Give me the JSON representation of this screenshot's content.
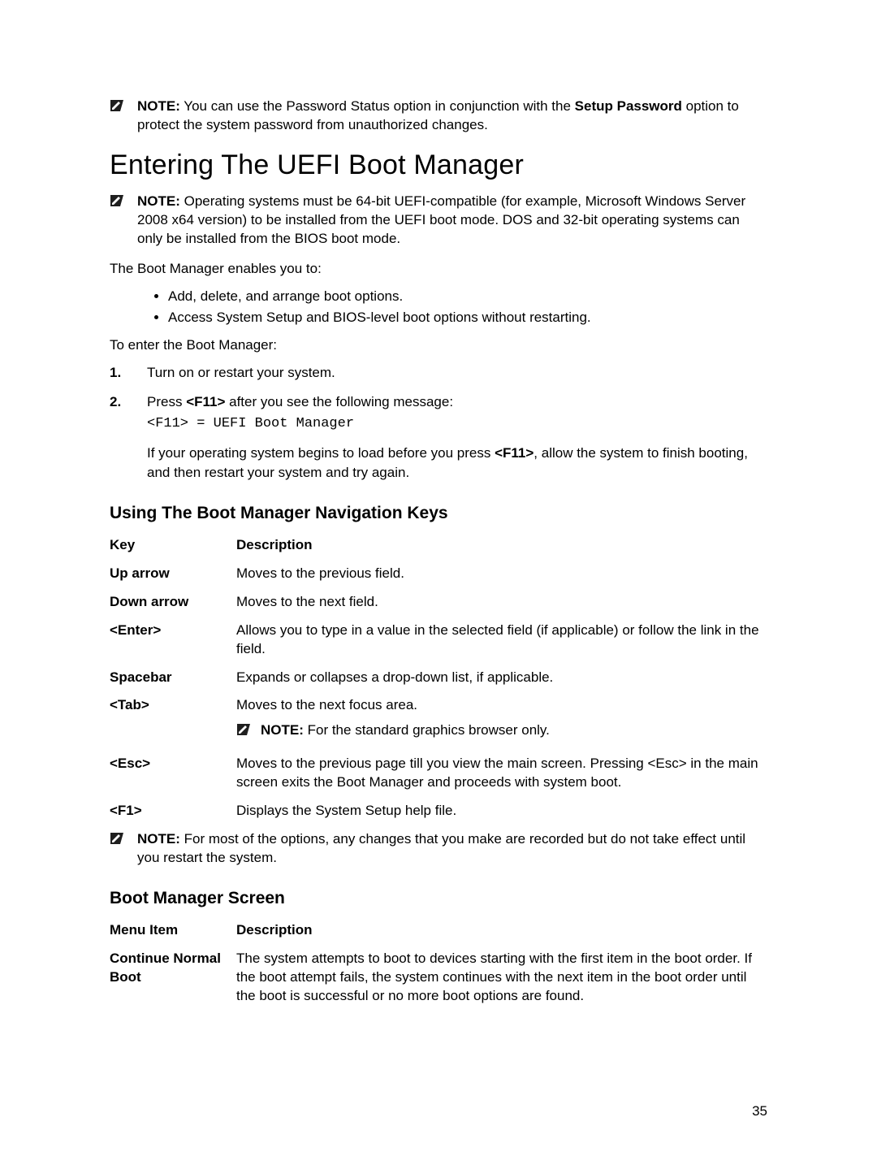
{
  "note_top": {
    "prefix": "NOTE:",
    "pre": " You can use the Password Status option in conjunction with the ",
    "bold": "Setup Password",
    "post": " option to protect the system password from unauthorized changes."
  },
  "heading_main": "Entering The UEFI Boot Manager",
  "note_uefi": {
    "prefix": "NOTE:",
    "body": " Operating systems must be 64-bit UEFI-compatible (for example, Microsoft Windows Server 2008 x64 version) to be installed from the UEFI boot mode. DOS and 32-bit operating systems can only be installed from the BIOS boot mode."
  },
  "para_enables": "The Boot Manager enables you to:",
  "bullets": [
    "Add, delete, and arrange boot options.",
    "Access System Setup and BIOS-level boot options without restarting."
  ],
  "para_to_enter": "To enter the Boot Manager:",
  "steps": {
    "s1": "Turn on or restart your system.",
    "s2_pre": "Press ",
    "s2_key": "<F11>",
    "s2_post": " after you see the following message:",
    "s2_mono": "<F11> = UEFI Boot Manager",
    "s2_sub_pre": "If your operating system begins to load before you press ",
    "s2_sub_key": "<F11>",
    "s2_sub_post": ", allow the system to finish booting, and then restart your system and try again."
  },
  "heading_nav": "Using The Boot Manager Navigation Keys",
  "navkeys": {
    "header_key": "Key",
    "header_desc": "Description",
    "rows": [
      {
        "key": "Up arrow",
        "desc": "Moves to the previous field."
      },
      {
        "key": "Down arrow",
        "desc": "Moves to the next field."
      },
      {
        "key": "<Enter>",
        "desc": "Allows you to type in a value in the selected field (if applicable) or follow the link in the field."
      },
      {
        "key": "Spacebar",
        "desc": "Expands or collapses a drop-down list, if applicable."
      }
    ],
    "tab_key": "<Tab>",
    "tab_desc": "Moves to the next focus area.",
    "tab_note_prefix": "NOTE:",
    "tab_note_body": " For the standard graphics browser only.",
    "rows2": [
      {
        "key": "<Esc>",
        "desc": "Moves to the previous page till you view the main screen. Pressing <Esc> in the main screen exits the Boot Manager and proceeds with system boot."
      },
      {
        "key": "<F1>",
        "desc": "Displays the System Setup help file."
      }
    ]
  },
  "note_restart": {
    "prefix": "NOTE:",
    "body": " For most of the options, any changes that you make are recorded but do not take effect until you restart the system."
  },
  "heading_bms": "Boot Manager Screen",
  "bms": {
    "header_item": "Menu Item",
    "header_desc": "Description",
    "row_key": "Continue Normal Boot",
    "row_desc": "The system attempts to boot to devices starting with the first item in the boot order. If the boot attempt fails, the system continues with the next item in the boot order until the boot is successful or no more boot options are found."
  },
  "page_number": "35"
}
